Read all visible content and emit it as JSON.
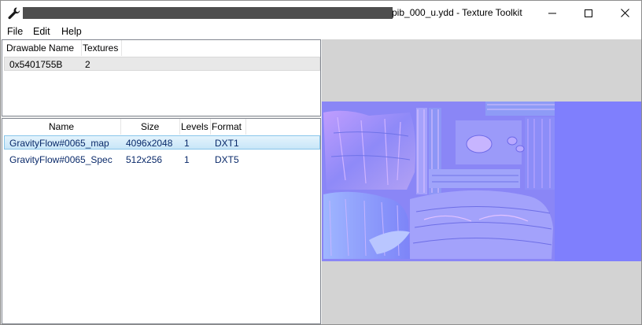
{
  "window": {
    "title": "pib_000_u.ydd - Texture Toolkit",
    "icon": "wrench-icon",
    "controls": [
      "minimize-icon",
      "maximize-icon",
      "close-icon"
    ]
  },
  "menu": {
    "items": [
      {
        "label": "File"
      },
      {
        "label": "Edit"
      },
      {
        "label": "Help"
      }
    ]
  },
  "drawables": {
    "columns": [
      "Drawable Name",
      "Textures"
    ],
    "rows": [
      {
        "name": "0x5401755B",
        "textures": "2"
      }
    ]
  },
  "textures": {
    "columns": [
      "Name",
      "Size",
      "Levels",
      "Format"
    ],
    "rows": [
      {
        "name": "GravityFlow#0065_map",
        "size": "4096x2048",
        "levels": "1",
        "format": "DXT1"
      },
      {
        "name": "GravityFlow#0065_Spec",
        "size": "512x256",
        "levels": "1",
        "format": "DXT5"
      }
    ]
  },
  "colors": {
    "normal_map_base": "#7f7ffd",
    "preview_background": "#d3d3d3",
    "selection_blue": "#cce8ff"
  }
}
